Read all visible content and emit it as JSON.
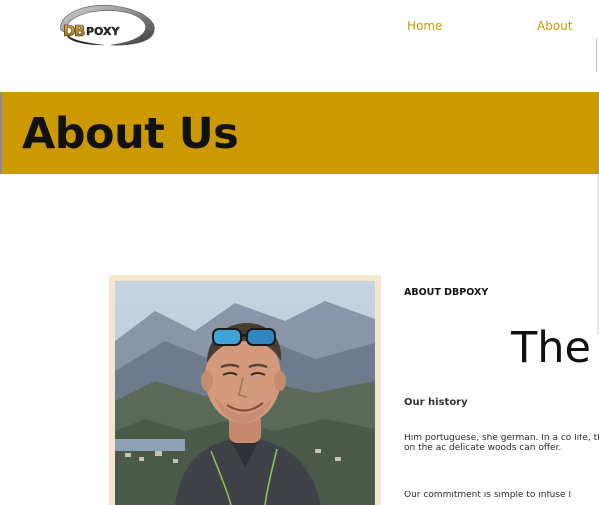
{
  "header": {
    "logo_text": "DBPOXY",
    "nav": [
      {
        "label": "Home"
      },
      {
        "label": "About"
      }
    ]
  },
  "hero": {
    "title": "About Us"
  },
  "about": {
    "eyebrow": "ABOUT DBPOXY",
    "heading_partial": "The",
    "subheading": "Our history",
    "paragraph_1": "Him portuguese, she german. In a co life, they decided to embark on the ac delicate woods can offer.",
    "paragraph_2": "Our commitment is simple to infuse l"
  },
  "colors": {
    "brand_gold": "#cc9a00",
    "nav_link": "#cc9a06",
    "photo_frame": "#f5e6cf",
    "text_dark": "#111111"
  },
  "icons": {
    "logo": "dbpoxy-swoosh-logo"
  }
}
